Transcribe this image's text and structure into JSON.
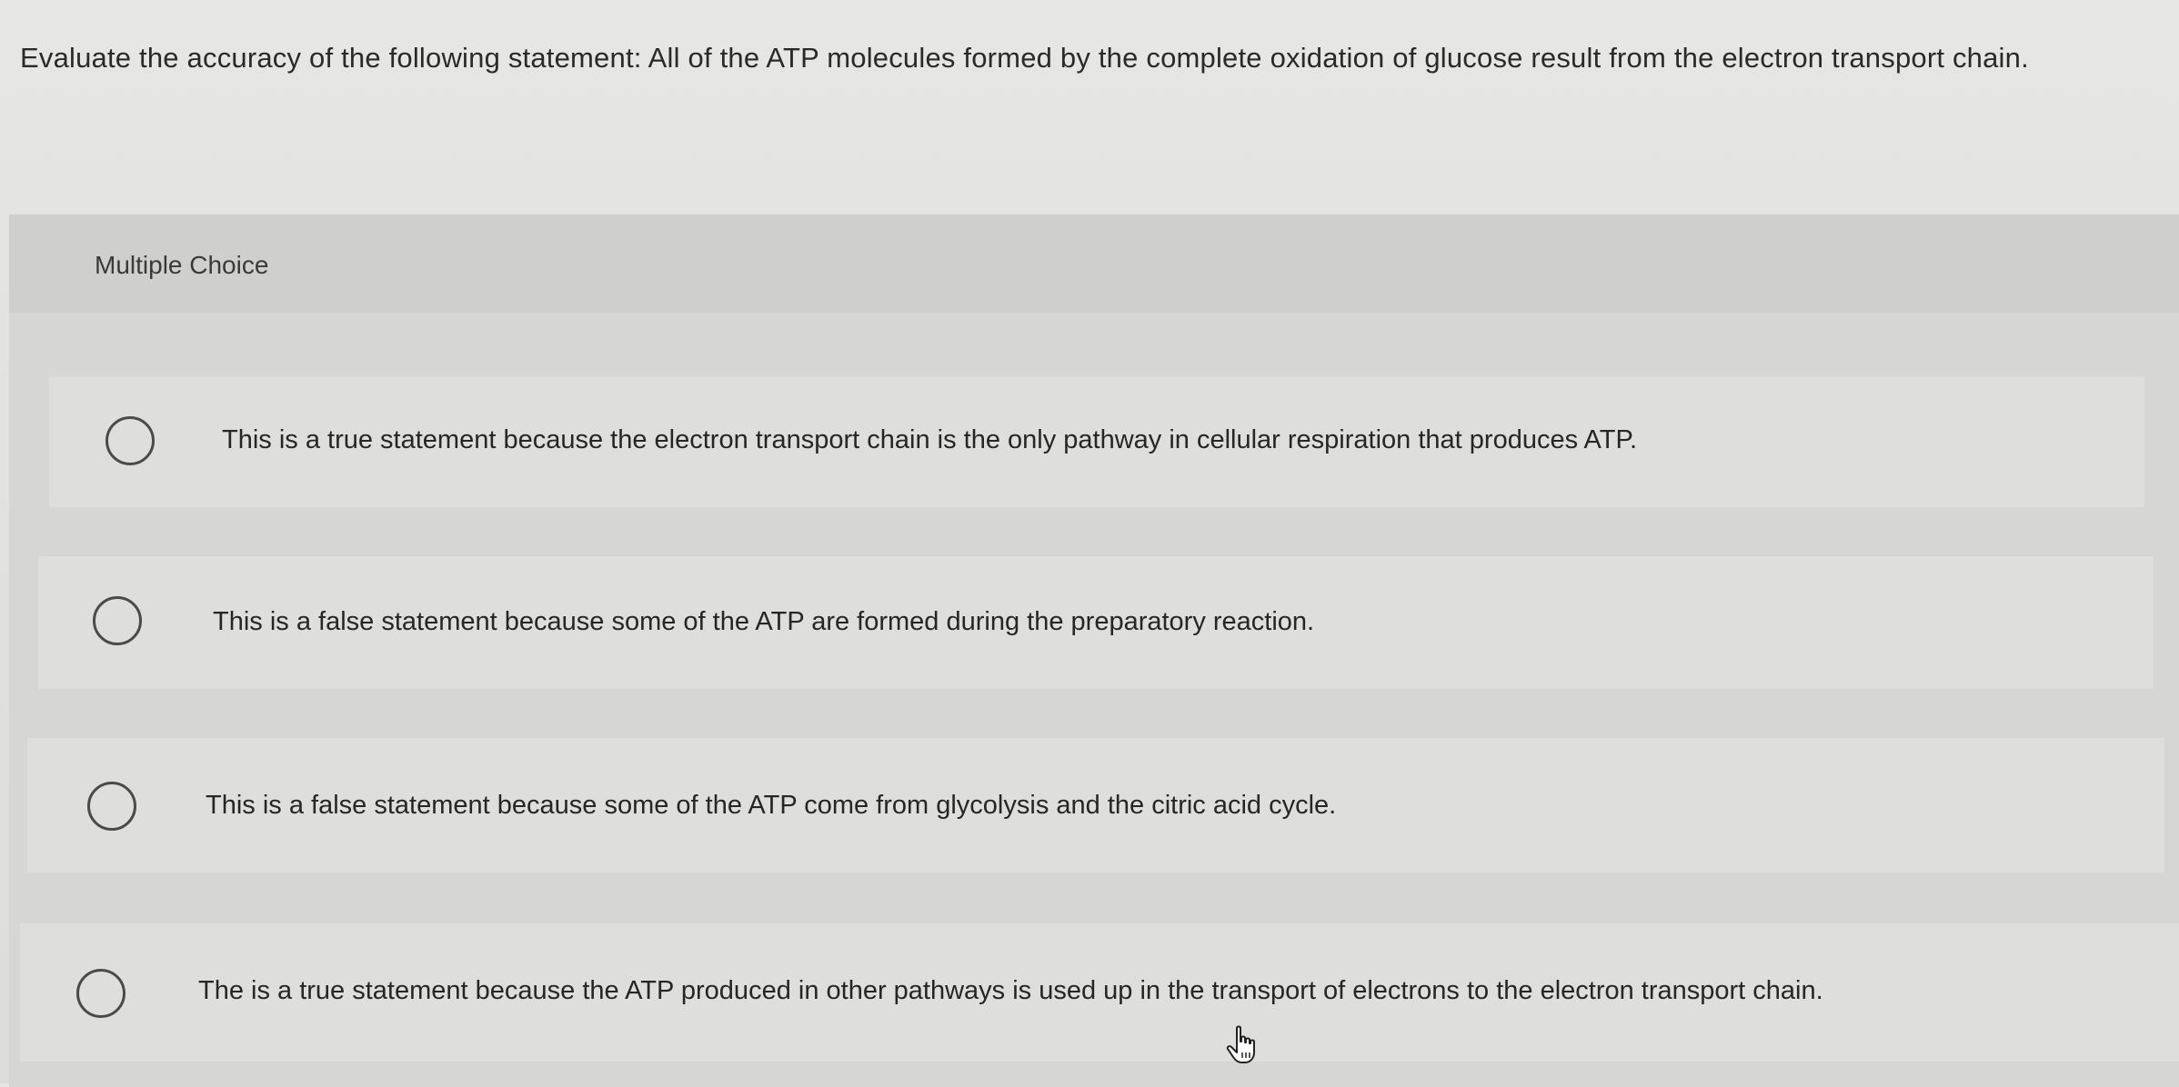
{
  "question": {
    "text": "Evaluate the accuracy of the following statement: All of the ATP molecules formed by the complete oxidation of glucose result from the electron transport chain."
  },
  "multiple_choice": {
    "label": "Multiple Choice",
    "options": [
      {
        "text": "This is a true statement because the electron transport chain is the only pathway in cellular respiration that produces ATP."
      },
      {
        "text": "This is a false statement because some of the ATP are formed during the preparatory reaction."
      },
      {
        "text": "This is a false statement because some of the ATP come from glycolysis and the citric acid cycle."
      },
      {
        "text": "The is a true statement because the ATP produced in other pathways is used up in the transport of electrons to the electron transport chain."
      }
    ]
  },
  "cursor": {
    "icon": "hand-pointer-icon"
  }
}
